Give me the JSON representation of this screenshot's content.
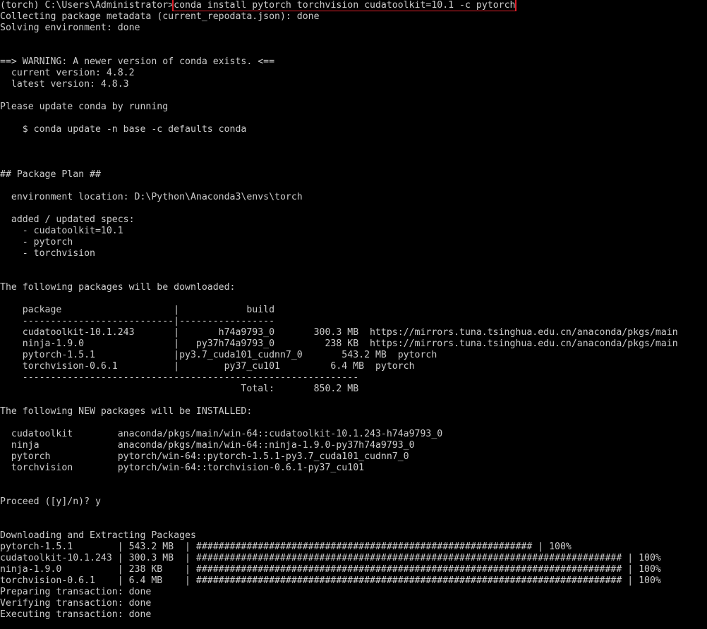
{
  "terminal": {
    "prompt": "(torch) C:\\Users\\Administrator>",
    "command": "conda install pytorch torchvision cudatoolkit=10.1 -c pytorch",
    "highlight_color": "#e0202a",
    "output": [
      "Collecting package metadata (current_repodata.json): done",
      "Solving environment: done",
      "",
      "",
      "==> WARNING: A newer version of conda exists. <==",
      "  current version: 4.8.2",
      "  latest version: 4.8.3",
      "",
      "Please update conda by running",
      "",
      "    $ conda update -n base -c defaults conda",
      "",
      "",
      "",
      "## Package Plan ##",
      "",
      "  environment location: D:\\Python\\Anaconda3\\envs\\torch",
      "",
      "  added / updated specs:",
      "    - cudatoolkit=10.1",
      "    - pytorch",
      "    - torchvision",
      "",
      "",
      "The following packages will be downloaded:",
      "",
      "    package                    |            build",
      "    ---------------------------|-----------------",
      "    cudatoolkit-10.1.243       |       h74a9793_0       300.3 MB  https://mirrors.tuna.tsinghua.edu.cn/anaconda/pkgs/main",
      "    ninja-1.9.0                |   py37h74a9793_0         238 KB  https://mirrors.tuna.tsinghua.edu.cn/anaconda/pkgs/main",
      "    pytorch-1.5.1              |py3.7_cuda101_cudnn7_0       543.2 MB  pytorch",
      "    torchvision-0.6.1          |        py37_cu101         6.4 MB  pytorch",
      "    ------------------------------------------------------------",
      "                                           Total:       850.2 MB",
      "",
      "The following NEW packages will be INSTALLED:",
      "",
      "  cudatoolkit        anaconda/pkgs/main/win-64::cudatoolkit-10.1.243-h74a9793_0",
      "  ninja              anaconda/pkgs/main/win-64::ninja-1.9.0-py37h74a9793_0",
      "  pytorch            pytorch/win-64::pytorch-1.5.1-py3.7_cuda101_cudnn7_0",
      "  torchvision        pytorch/win-64::torchvision-0.6.1-py37_cu101",
      "",
      "",
      "Proceed ([y]/n)? y",
      "",
      "",
      "Downloading and Extracting Packages",
      "pytorch-1.5.1        | 543.2 MB  | ############################################################ | 100%",
      "cudatoolkit-10.1.243 | 300.3 MB  | ############################################################################ | 100%",
      "ninja-1.9.0          | 238 KB    | ############################################################################ | 100%",
      "torchvision-0.6.1    | 6.4 MB    | ############################################################################ | 100%",
      "Preparing transaction: done",
      "Verifying transaction: done",
      "Executing transaction: done"
    ]
  }
}
